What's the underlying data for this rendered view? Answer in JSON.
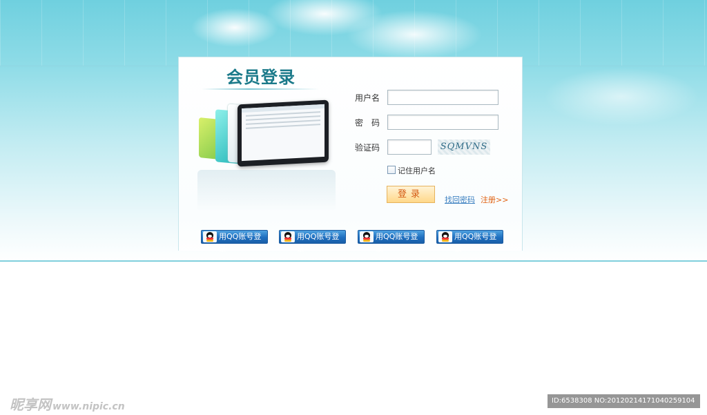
{
  "panel": {
    "title": "会员登录"
  },
  "form": {
    "username_label": "用户名",
    "username_value": "",
    "password_label": "密　码",
    "password_value": "",
    "captcha_label": "验证码",
    "captcha_value": "",
    "captcha_image_text": "SQMVNS",
    "remember_label": "记住用户名",
    "remember_checked": false,
    "login_label": "登录",
    "forgot_label": "找回密码",
    "register_label": "注册>>"
  },
  "qq_buttons": [
    {
      "label": "用QQ账号登录"
    },
    {
      "label": "用QQ账号登录"
    },
    {
      "label": "用QQ账号登录"
    },
    {
      "label": "用QQ账号登录"
    }
  ],
  "watermark": {
    "left_text": "昵享网",
    "left_url": "www.nipic.cn",
    "right_text": "ID:6538308 NO:20120214171040259104"
  },
  "colors": {
    "title": "#1b7a8a",
    "login_text": "#d35a13",
    "qq_button": "#1f6fbf",
    "register_link": "#e06010",
    "forgot_link": "#3a7fc0"
  }
}
